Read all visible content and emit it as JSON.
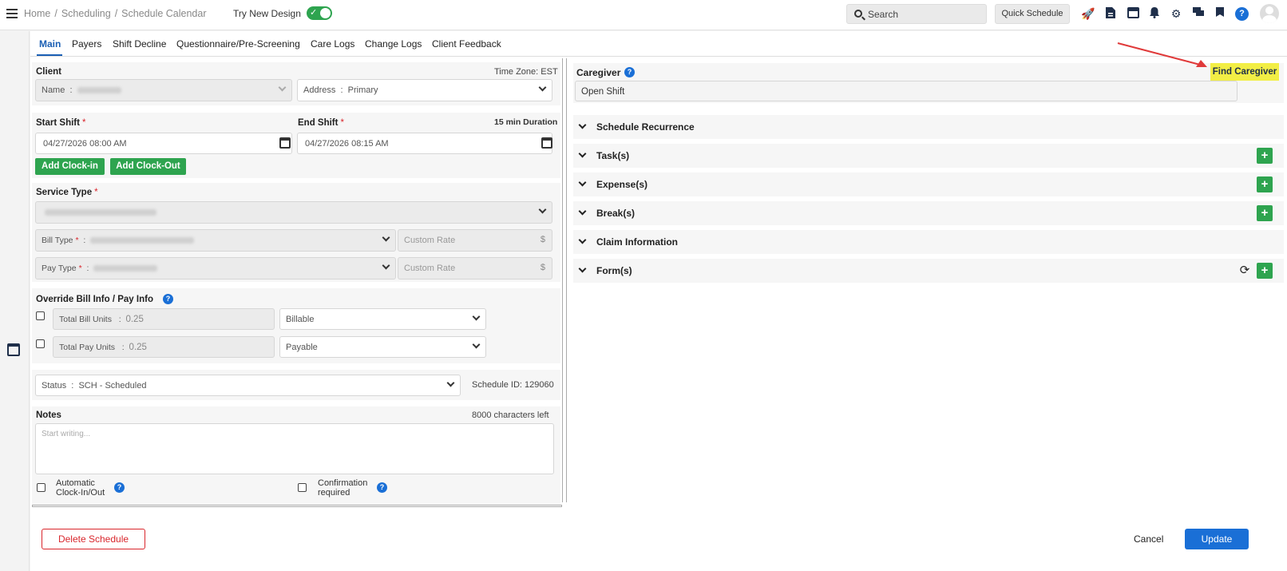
{
  "breadcrumb": [
    "Home",
    "Scheduling",
    "Schedule Calendar"
  ],
  "try_new_design": "Try New Design",
  "search": {
    "label": "Search"
  },
  "quick_schedule": "Quick Schedule",
  "tabs": [
    "Main",
    "Payers",
    "Shift Decline",
    "Questionnaire/Pre-Screening",
    "Care Logs",
    "Change Logs",
    "Client Feedback"
  ],
  "client": {
    "heading": "Client",
    "timezone": "Time Zone: EST",
    "name_label": "Name",
    "address_label": "Address",
    "address_value": "Primary"
  },
  "shift": {
    "start_label": "Start Shift",
    "end_label": "End Shift",
    "duration": "15 min Duration",
    "start_value": "04/27/2026 08:00 AM",
    "end_value": "04/27/2026 08:15 AM",
    "add_clock_in": "Add Clock-in",
    "add_clock_out": "Add Clock-Out"
  },
  "service": {
    "heading": "Service Type",
    "bill_type_label": "Bill Type",
    "pay_type_label": "Pay Type",
    "custom_rate": "Custom Rate",
    "currency": "$"
  },
  "override": {
    "heading": "Override Bill Info / Pay Info",
    "total_bill_units_label": "Total Bill Units",
    "total_bill_units_value": "0.25",
    "billable": "Billable",
    "total_pay_units_label": "Total Pay Units",
    "total_pay_units_value": "0.25",
    "payable": "Payable"
  },
  "status": {
    "label": "Status",
    "value": "SCH - Scheduled",
    "schedule_id": "Schedule ID: 129060"
  },
  "notes": {
    "heading": "Notes",
    "chars_left": "8000 characters left",
    "placeholder": "Start writing...",
    "auto_clock_1": "Automatic",
    "auto_clock_2": "Clock-In/Out",
    "confirm_1": "Confirmation",
    "confirm_2": "required"
  },
  "caregiver": {
    "heading": "Caregiver",
    "value": "Open Shift",
    "find_button": "Find Caregiver"
  },
  "accordions": [
    "Schedule Recurrence",
    "Task(s)",
    "Expense(s)",
    "Break(s)",
    "Claim Information",
    "Form(s)"
  ],
  "footer": {
    "delete": "Delete Schedule",
    "cancel": "Cancel",
    "update": "Update"
  },
  "colors": {
    "primary": "#1a6fd6",
    "success": "#2ea44f",
    "danger": "#d9262c",
    "highlight": "#f2ee45"
  }
}
